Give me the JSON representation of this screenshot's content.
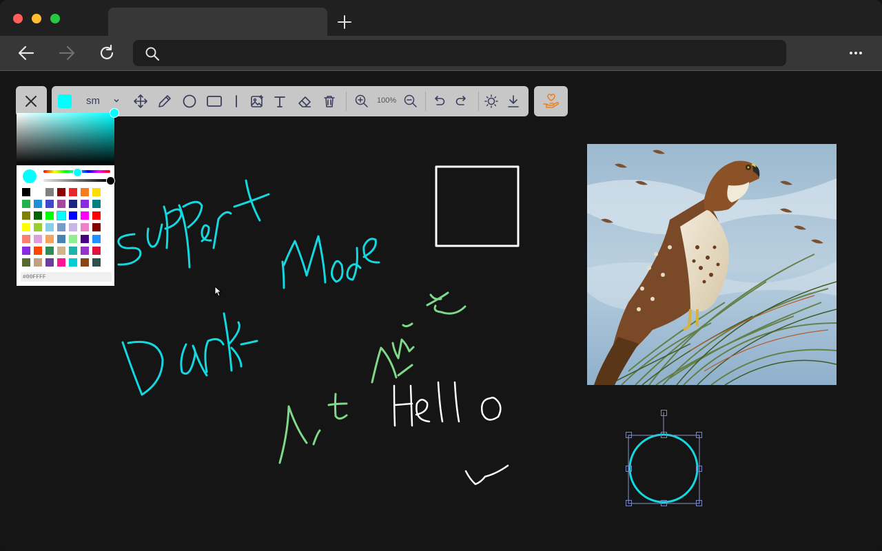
{
  "browser": {
    "traffic_lights": [
      "#ff5f57",
      "#febc2e",
      "#28c840"
    ],
    "tab_title": "",
    "new_tab_icon": "plus-icon",
    "address": {
      "value": "",
      "placeholder": ""
    }
  },
  "toolbar": {
    "close_icon": "close-icon",
    "current_color": "#00FFFF",
    "brush_size": "sm",
    "zoom_level": "100%",
    "tools": [
      "move-icon",
      "pencil-icon",
      "circle-icon",
      "rectangle-icon",
      "line-icon",
      "image-icon",
      "text-icon",
      "eraser-icon",
      "trash-icon",
      "zoom-in-icon",
      "zoom-out-icon",
      "undo-icon",
      "redo-icon",
      "theme-icon",
      "download-icon"
    ],
    "donate_icon": "donate-icon"
  },
  "color_picker": {
    "hex_value": "#00FFFF",
    "presets": [
      "#000000",
      "#ffffff",
      "#808080",
      "#8b0000",
      "#e5282a",
      "#f47b20",
      "#ffdd00",
      "#22b14c",
      "#1e8fd5",
      "#3f48cc",
      "#a349a4",
      "#1a237e",
      "#8a2be2",
      "#008080",
      "#808000",
      "#006400",
      "#00ff00",
      "#00ffff",
      "#0000ff",
      "#ff00ff",
      "#ff0000",
      "#ffff00",
      "#9acd32",
      "#87ceeb",
      "#7b9acc",
      "#c8b6e2",
      "#ee82c8",
      "#800000",
      "#fa8072",
      "#dda0dd",
      "#f4a460",
      "#4682b4",
      "#90ee90",
      "#4b0082",
      "#1e90ff",
      "#8a2be2",
      "#ff4500",
      "#2e8b57",
      "#d2b48c",
      "#20b2aa",
      "#9932cc",
      "#dc143c",
      "#556b2f",
      "#c0a080",
      "#6a3d9a",
      "#ff1493",
      "#00ced1",
      "#8b4513",
      "#2f4f4f"
    ]
  },
  "canvas": {
    "image": "hawk-painting",
    "selected_shape": "circle"
  }
}
